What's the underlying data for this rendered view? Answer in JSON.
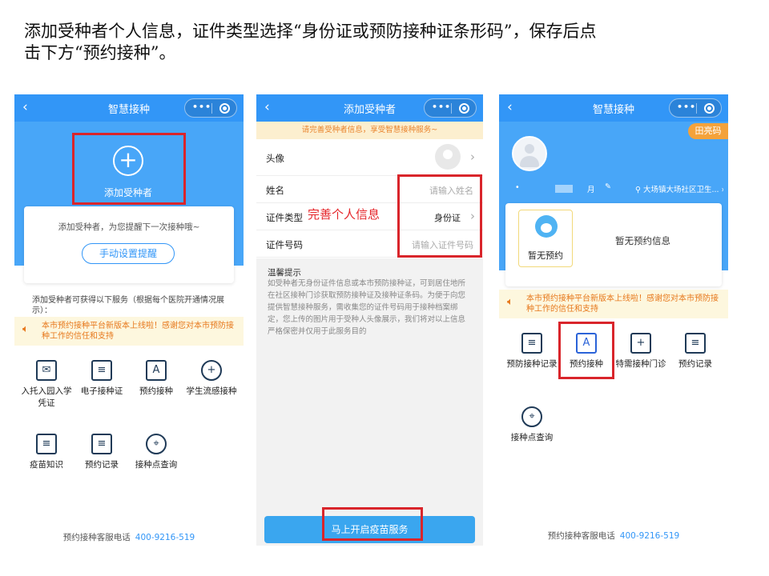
{
  "instruction": {
    "line1": "添加受种者个人信息，证件类型选择“身份证或预防接种证条形码”，保存后点",
    "line2": "击下方“预约接种”。"
  },
  "capsule": {
    "dots": "•••"
  },
  "phone1": {
    "title": "智慧接种",
    "add_label": "添加受种者",
    "remind_text": "添加受种者，为您提醒下一次接种哦~",
    "remind_button": "手动设置提醒",
    "service_note": "添加受种者可获得以下服务（根据每个医院开通情况展示）：",
    "notice": "本市预约接种平台新版本上线啦！感谢您对本市预防接种工作的信任和支持",
    "grid": [
      {
        "label": "入托入园入学凭证",
        "icon": "envelope-icon",
        "glyph": "✉"
      },
      {
        "label": "电子接种证",
        "icon": "id-card-icon",
        "glyph": "≡"
      },
      {
        "label": "预约接种",
        "icon": "clipboard-icon",
        "glyph": "A"
      },
      {
        "label": "学生流感接种",
        "icon": "mask-icon",
        "glyph": "+"
      },
      {
        "label": "疫苗知识",
        "icon": "book-icon",
        "glyph": "≡"
      },
      {
        "label": "预约记录",
        "icon": "document-icon",
        "glyph": "≡"
      },
      {
        "label": "接种点查询",
        "icon": "location-icon",
        "glyph": "⌖"
      }
    ],
    "footer_label": "预约接种客服电话",
    "footer_phone": "400-9216-519"
  },
  "phone2": {
    "title": "添加受种者",
    "banner": "请完善受种者信息，享受智慧接种服务~",
    "rows": {
      "avatar_label": "头像",
      "name_label": "姓名",
      "name_placeholder": "请输入姓名",
      "doc_type_label": "证件类型",
      "doc_type_value": "身份证",
      "doc_no_label": "证件号码",
      "doc_no_placeholder": "请输入证件号码"
    },
    "overlay_text": "完善个人信息",
    "tips_title": "温馨提示",
    "tips_body": "如受种者无身份证件信息或本市预防接种证，可到居住地所在社区接种门诊获取预防接种证及接种证条码。为便于向您提供智慧接种服务，需收集您的证件号码用于接种档案绑定，您上传的图片用于受种人头像展示，我们将对以上信息严格保密并仅用于此服务目的",
    "submit_button": "马上开启疫苗服务"
  },
  "phone3": {
    "title": "智慧接种",
    "qr_badge": "田亮码",
    "month": "月",
    "location": "大场镇大场社区卫生...",
    "mascot_label": "暂无预约",
    "no_appointment": "暂无预约信息",
    "notice": "本市预约接种平台新版本上线啦！感谢您对本市预防接种工作的信任和支持",
    "grid": [
      {
        "label": "预防接种记录",
        "icon": "id-card-icon",
        "glyph": "≡"
      },
      {
        "label": "预约接种",
        "icon": "clipboard-icon",
        "glyph": "A"
      },
      {
        "label": "特需接种门诊",
        "icon": "clinic-icon",
        "glyph": "+"
      },
      {
        "label": "预约记录",
        "icon": "document-icon",
        "glyph": "≡"
      },
      {
        "label": "接种点查询",
        "icon": "location-icon",
        "glyph": "⌖"
      }
    ],
    "footer_label": "预约接种客服电话",
    "footer_phone": "400-9216-519"
  },
  "colors": {
    "primary": "#3296f7",
    "highlight": "#d9252b",
    "notice": "#e7781c"
  }
}
